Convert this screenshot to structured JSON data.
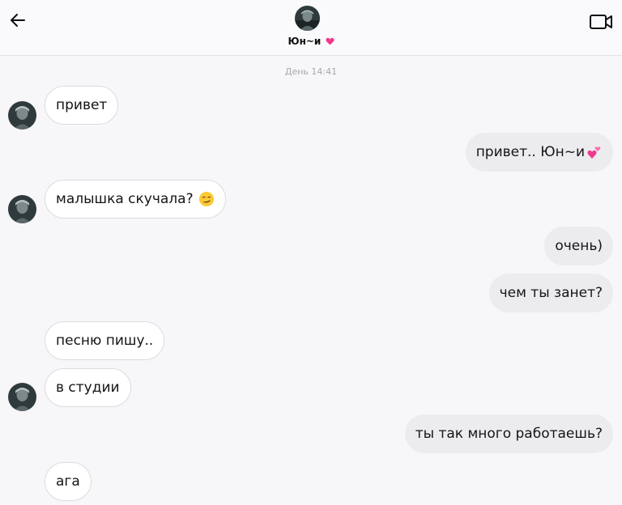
{
  "header": {
    "contact_name": "Юн~и",
    "name_emoji": "pink-heart-icon"
  },
  "conversation": {
    "timestamp": "День 14:41"
  },
  "messages": [
    {
      "side": "in",
      "text": "привет"
    },
    {
      "side": "out",
      "text": "привет.. Юн~и",
      "emoji": "two-hearts-icon"
    },
    {
      "side": "in",
      "text": "малышка скучала?",
      "emoji": "smirk-face-icon"
    },
    {
      "side": "out",
      "text": "очень)"
    },
    {
      "side": "out",
      "text": "чем ты занет?"
    },
    {
      "side": "in",
      "text": "песню пишу.."
    },
    {
      "side": "in",
      "text": "в студии"
    },
    {
      "side": "out",
      "text": "ты так много работаешь?"
    },
    {
      "side": "in",
      "text": "ага"
    }
  ],
  "colors": {
    "background": "#f7f6f9",
    "incoming_bubble": "#ffffff",
    "outgoing_bubble": "#ececef",
    "heart": "#f0388c"
  }
}
